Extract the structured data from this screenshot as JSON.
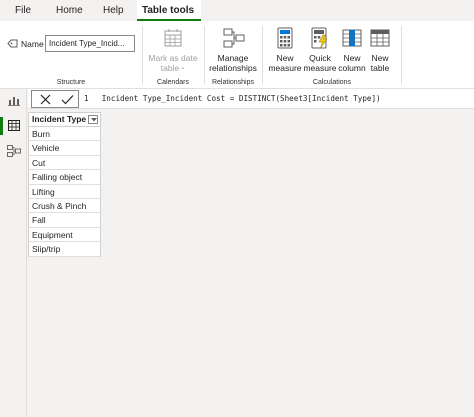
{
  "tabs": [
    {
      "label": "File"
    },
    {
      "label": "Home"
    },
    {
      "label": "Help"
    },
    {
      "label": "Table tools"
    }
  ],
  "ribbon": {
    "structure": {
      "name_label": "Name",
      "name_value": "Incident Type_Incid...",
      "group_label": "Structure"
    },
    "calendars": {
      "mark_as_date_line1": "Mark as date",
      "mark_as_date_line2": "table",
      "group_label": "Calendars"
    },
    "relationships": {
      "manage_line1": "Manage",
      "manage_line2": "relationships",
      "group_label": "Relationships"
    },
    "calculations": {
      "new_measure_line1": "New",
      "new_measure_line2": "measure",
      "quick_measure_line1": "Quick",
      "quick_measure_line2": "measure",
      "new_column_line1": "New",
      "new_column_line2": "column",
      "new_table_line1": "New",
      "new_table_line2": "table",
      "group_label": "Calculations"
    }
  },
  "formula": {
    "line_number": "1",
    "text": "Incident Type_Incident Cost = DISTINCT(Sheet3[Incident Type])"
  },
  "table": {
    "header": "Incident Type",
    "rows": [
      "Burn",
      "Vehicle",
      "Cut",
      "Falling object",
      "Lifting",
      "Crush & Pinch",
      "Fall",
      "Equipment",
      "Slip/trip"
    ]
  },
  "colors": {
    "accent": "#107c10",
    "calc_icon_blue": "#0078d4",
    "quick_measure_yellow": "#f2c811"
  }
}
